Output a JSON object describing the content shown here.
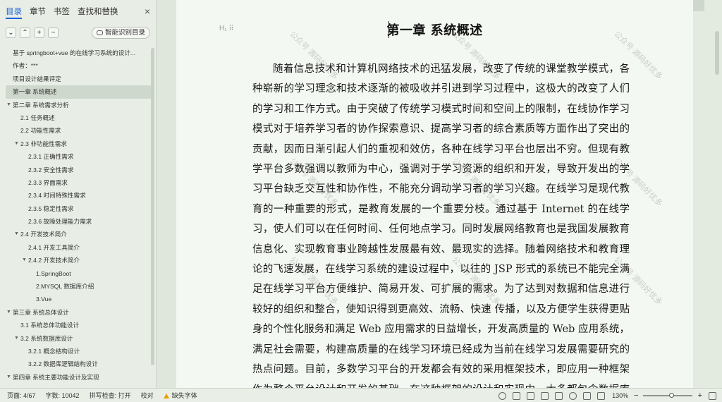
{
  "sidebar": {
    "tabs": [
      "目录",
      "章节",
      "书签",
      "查找和替换"
    ],
    "close": "×",
    "tool_buttons": [
      "⌄",
      "⌃",
      "+",
      "−"
    ],
    "ai_button_label": "智能识别目录",
    "toc": [
      {
        "label": "基于 springboot+vue 的在线学习系统的设计...",
        "level": 1,
        "caret": ""
      },
      {
        "label": "作者：***",
        "level": 1,
        "caret": ""
      },
      {
        "label": "项目设计结果评定",
        "level": 1,
        "caret": ""
      },
      {
        "label": "第一章 系统概述",
        "level": 1,
        "caret": "",
        "selected": true
      },
      {
        "label": "第二章 系统需求分析",
        "level": 1,
        "caret": "▼"
      },
      {
        "label": "2.1 任务概述",
        "level": 2,
        "caret": ""
      },
      {
        "label": "2.2 功能性需求",
        "level": 2,
        "caret": ""
      },
      {
        "label": "2.3 非功能性需求",
        "level": 2,
        "caret": "▼"
      },
      {
        "label": "2.3.1 正确性需求",
        "level": 3,
        "caret": ""
      },
      {
        "label": "2.3.2 安全性需求",
        "level": 3,
        "caret": ""
      },
      {
        "label": "2.3.3 界面需求",
        "level": 3,
        "caret": ""
      },
      {
        "label": "2.3.4 时间特殊性需求",
        "level": 3,
        "caret": ""
      },
      {
        "label": "2.3.5 稳定性需求",
        "level": 3,
        "caret": ""
      },
      {
        "label": "2.3.6 故障处理能力需求",
        "level": 3,
        "caret": ""
      },
      {
        "label": "2.4 开发技术简介",
        "level": 2,
        "caret": "▼"
      },
      {
        "label": "2.4.1 开发工具简介",
        "level": 3,
        "caret": ""
      },
      {
        "label": "2.4.2 开发技术简介",
        "level": 3,
        "caret": "▼"
      },
      {
        "label": "1.SpringBoot",
        "level": 4,
        "caret": ""
      },
      {
        "label": "2.MYSQL 数据库介绍",
        "level": 4,
        "caret": ""
      },
      {
        "label": "3.Vue",
        "level": 4,
        "caret": ""
      },
      {
        "label": "第三章 系统总体设计",
        "level": 1,
        "caret": "▼"
      },
      {
        "label": "3.1 系统总体功能设计",
        "level": 2,
        "caret": ""
      },
      {
        "label": "3.2 系统数据库设计",
        "level": 2,
        "caret": "▼"
      },
      {
        "label": "3.2.1 概念结构设计",
        "level": 3,
        "caret": ""
      },
      {
        "label": "3.2.2 数据库逻辑结构设计",
        "level": 3,
        "caret": ""
      },
      {
        "label": "第四章 系统主要功能设计及实现",
        "level": 1,
        "caret": "▼"
      }
    ]
  },
  "document": {
    "heading_marker": "H₁ ⠿",
    "chapter_title": "第一章 系统概述",
    "paragraph": "随着信息技术和计算机网络技术的迅猛发展，改变了传统的课堂教学模式，各种崭新的学习理念和技术逐渐的被吸收并引进到学习过程中，这极大的改变了人们的学习和工作方式。由于突破了传统学习模式时间和空间上的限制，在线协作学习模式对于培养学习者的协作探索意识、提高学习者的综合素质等方面作出了突出的贡献，因而日渐引起人们的重视和效仿，各种在线学习平台也层出不穷。但现有教学平台多数强调以教师为中心，强调对于学习资源的组织和开发，导致开发出的学习平台缺乏交互性和协作性，不能充分调动学习者的学习兴趣。在线学习是现代教育的一种重要的形式，是教育发展的一个重要分枝。通过基于 Internet 的在线学习，使人们可以在任何时间、任何地点学习。同时发展网络教育也是我国发展教育信息化、实现教育事业跨越性发展最有效、最现实的选择。随着网络技术和教育理论的飞速发展，在线学习系统的建设过程中，以往的 JSP 形式的系统已不能完全满足在线学习平台方便维护、简易开发、可扩展的需求。为了达到对数据和信息进行较好的组织和整合，使知识得到更高效、流畅、快速 传播，以及方便学生获得更贴身的个性化服务和满足 Web 应用需求的日益增长，开发高质量的 Web 应用系统，满足社会需要，构建高质量的在线学习环境已经成为当前在线学习发展需要研究的热点问题。目前，多数学习平台的开发都会有效的采用框架技术，即应用一种框架作为整个平台设计和开发的基础。在这种框架的设计和实现中，大多都包含数据库访问",
    "watermark": "公众号 源码好优多"
  },
  "status": {
    "page": "页面: 4/67",
    "words": "字数: 10042",
    "spellcheck": "拼写检查: 打开",
    "proofread": "校对",
    "missing_font": "缺失字体",
    "zoom": "130%",
    "zoom_level": 0.6
  }
}
